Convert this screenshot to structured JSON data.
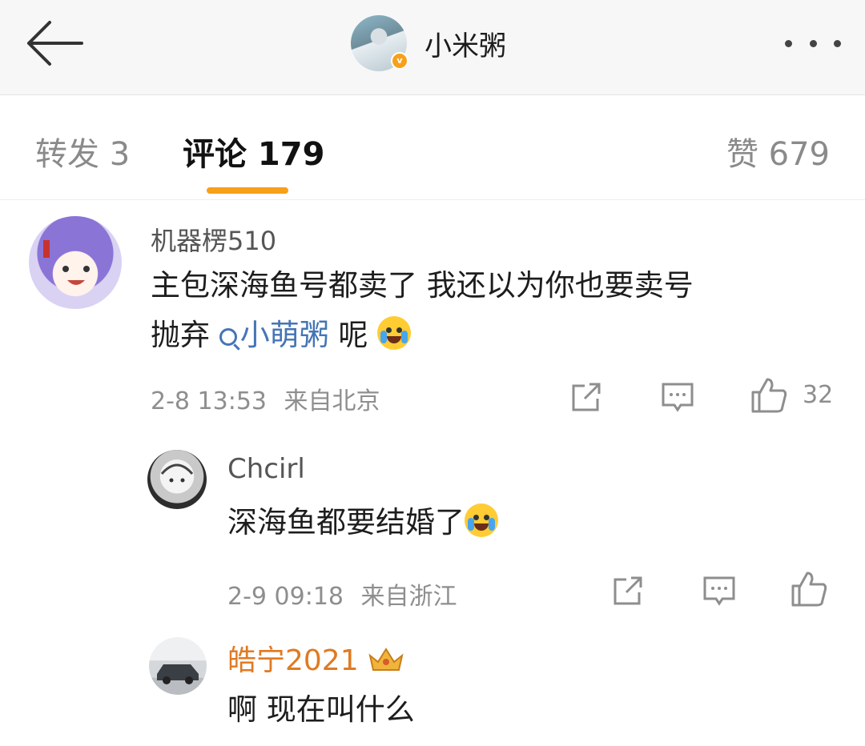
{
  "header": {
    "title": "小米粥",
    "verified_badge": "v",
    "back_icon": "arrow-left-icon",
    "more_icon": "more-dots-icon"
  },
  "tabs": {
    "repost": "转发 3",
    "comment": "评论 179",
    "like": "赞 679"
  },
  "colors": {
    "accent": "#f7a01a",
    "link": "#4575b5",
    "vip": "#e07a22"
  },
  "comments": [
    {
      "username": "机器楞510",
      "text_part1": "主包深海鱼号都卖了 我还以为你也要卖号",
      "text_part2": "抛弃",
      "mention": "小萌粥",
      "text_part3": " 呢",
      "emoji": "crying-face",
      "time": "2-8 13:53",
      "location": "来自北京",
      "likes": "32"
    },
    {
      "username": "Chcirl",
      "text": "深海鱼都要结婚了",
      "emoji": "laughing-tears-face",
      "time": "2-9 09:18",
      "location": "来自浙江"
    },
    {
      "username": "皓宁2021",
      "text": "啊 现在叫什么",
      "badge_icon": "crown-icon"
    }
  ]
}
